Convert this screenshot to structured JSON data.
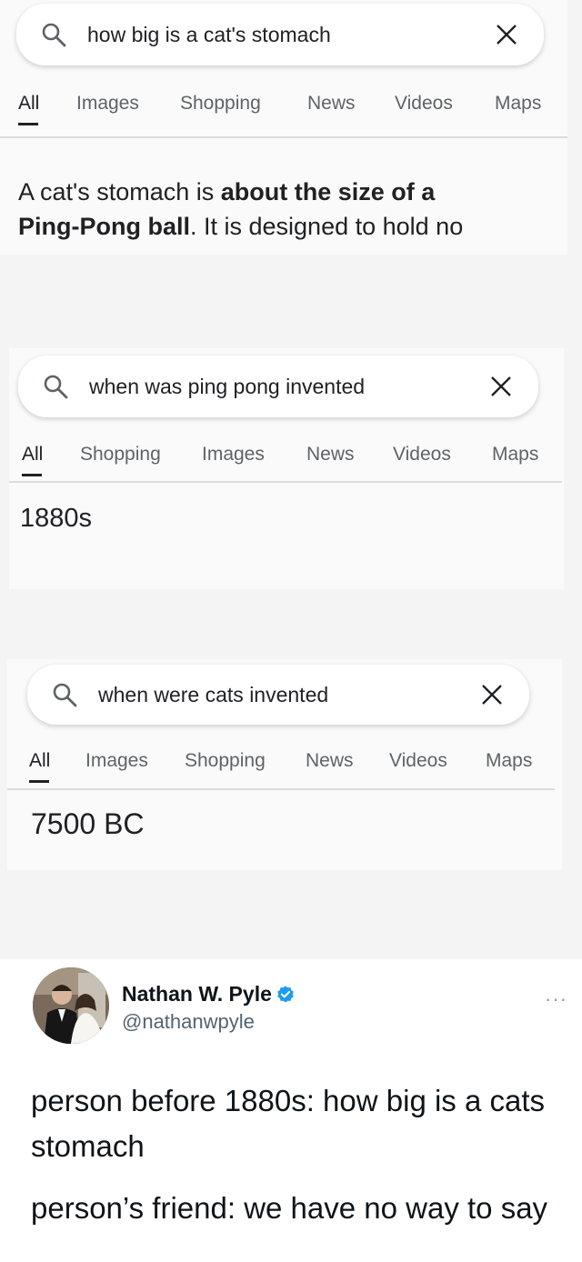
{
  "search1": {
    "query": "how big is a cat's stomach",
    "tabs": [
      "All",
      "Images",
      "Shopping",
      "News",
      "Videos",
      "Maps"
    ],
    "snippet_parts": [
      {
        "text": "A cat's stomach is ",
        "bold": false
      },
      {
        "text": "about the size of a",
        "bold": true
      },
      {
        "text": "Ping-Pong ball",
        "bold": true
      },
      {
        "text": ". It is designed to hold no",
        "bold": false
      }
    ]
  },
  "search2": {
    "query": "when was ping pong invented",
    "tabs": [
      "All",
      "Shopping",
      "Images",
      "News",
      "Videos",
      "Maps"
    ],
    "answer": "1880s"
  },
  "search3": {
    "query": "when were cats invented",
    "tabs": [
      "All",
      "Images",
      "Shopping",
      "News",
      "Videos",
      "Maps"
    ],
    "answer": "7500 BC"
  },
  "tweet": {
    "name": "Nathan W. Pyle",
    "handle": "@nathanwpyle",
    "more": "···",
    "lines": [
      "person before 1880s: how big is a cats",
      "stomach",
      "person’s friend: we have no way to say"
    ]
  },
  "icons": {
    "search": "search-icon",
    "close": "close-icon",
    "verified": "verified-badge-icon"
  },
  "colors": {
    "verified": "#1d9bf0",
    "search_icon": "#5f6368"
  }
}
